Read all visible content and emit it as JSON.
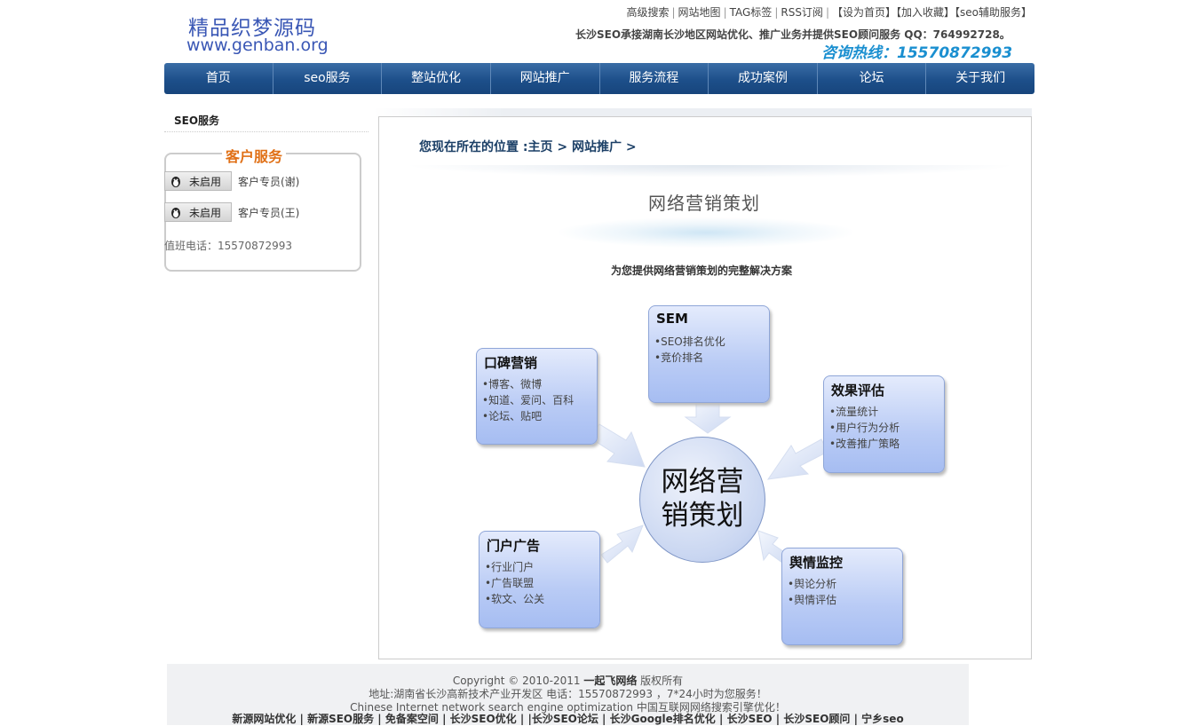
{
  "logo": {
    "cn": "精品织梦源码",
    "url": "www.genban.org"
  },
  "toplinks": [
    "高级搜索",
    "网站地图",
    "TAG标签",
    "RSS订阅",
    "【设为首页】",
    "【加入收藏】",
    "【seo辅助服务】"
  ],
  "slogan": "长沙SEO承接湖南长沙地区网站优化、推广业务并提供SEO顾问服务 QQ：764992728。",
  "hotline": "咨询热线：15570872993",
  "nav": [
    "首页",
    "seo服务",
    "整站优化",
    "网站推广",
    "服务流程",
    "成功案例",
    "论坛",
    "关于我们"
  ],
  "sidebar": {
    "title": "SEO服务",
    "service_title": "客户服务",
    "qq": [
      {
        "button": "未启用",
        "name": "客户专员(谢)"
      },
      {
        "button": "未启用",
        "name": "客户专员(王)"
      }
    ],
    "duty_phone": "值班电话：15570872993"
  },
  "breadcrumb": {
    "label": "您现在所在的位置 :",
    "items": [
      "主页",
      "网站推广"
    ],
    "sep": ">"
  },
  "diagram": {
    "title": "网络营销策划",
    "subtitle": "为您提供网络营销策划的完整解决方案",
    "center": [
      "网络营",
      "销策划"
    ],
    "nodes": {
      "sem": {
        "title": "SEM",
        "items": [
          "SEO排名优化",
          "竞价排名"
        ]
      },
      "koubei": {
        "title": "口碑营销",
        "items": [
          "博客、微博",
          "知道、爱问、百科",
          "论坛、贴吧"
        ]
      },
      "xiaoguo": {
        "title": "效果评估",
        "items": [
          "流量统计",
          "用户行为分析",
          "改善推广策略"
        ]
      },
      "menhu": {
        "title": "门户广告",
        "items": [
          "行业门户",
          "广告联盟",
          "软文、公关"
        ]
      },
      "yuqing": {
        "title": "舆情监控",
        "items": [
          "舆论分析",
          "舆情评估"
        ]
      }
    },
    "colors": {
      "card_top": "#e4ebfc",
      "card_bottom": "#a6bdf2",
      "arrow": "#dfe6f6"
    }
  },
  "footer": {
    "copyright_pre": "Copyright © 2010-2011 ",
    "copyright_brand": "一起飞网络",
    "copyright_post": " 版权所有",
    "address": "地址:湖南省长沙高新技术产业开发区 电话：15570872993 ，7*24小时为您服务！",
    "english": "Chinese Internet network search engine optimization 中国互联网网络搜索引擎优化！",
    "links": [
      "新源网站优化",
      "新源SEO服务",
      "免备案空间",
      "长沙SEO优化",
      "|长沙SEO论坛",
      "长沙Google排名优化",
      " 长沙SEO",
      "长沙SEO顾问",
      "宁乡seo"
    ]
  }
}
